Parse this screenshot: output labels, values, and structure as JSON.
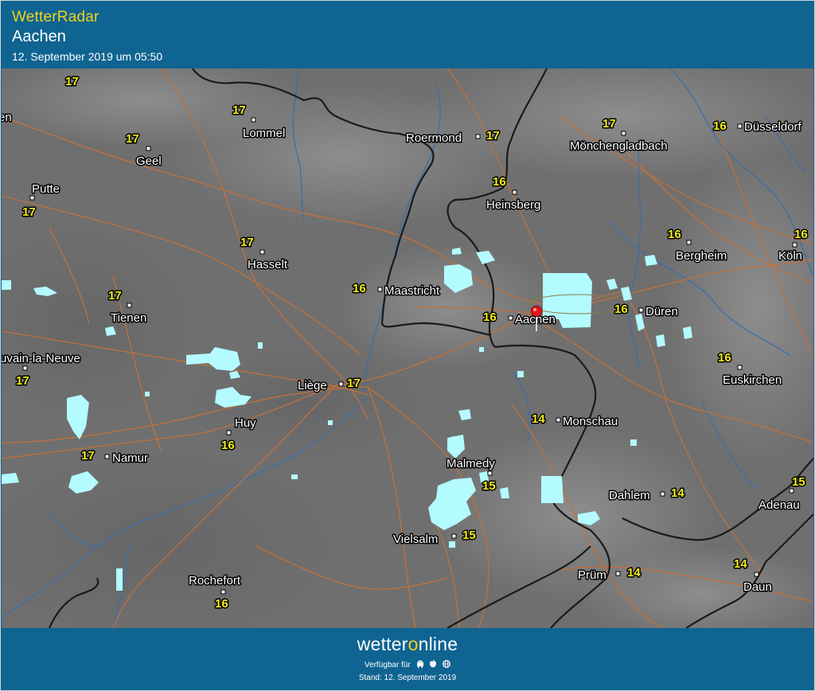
{
  "header": {
    "app_title": "WetterRadar",
    "location": "Aachen",
    "timestamp": "12. September 2019 um 05:50"
  },
  "footer": {
    "logo_pre": "wetter",
    "logo_o": "o",
    "logo_post": "nline",
    "available_label": "Verfügbar für",
    "platform_icons": [
      "android-icon",
      "apple-icon",
      "web-icon"
    ],
    "stand_label": "Stand: 12. September 2019"
  },
  "colors": {
    "header_bg": "#0f6491",
    "brand_yellow": "#f2d21b",
    "temperature_yellow": "#f5ee16",
    "precipitation": "#b3fbff",
    "road": "#c2703a",
    "border": "#1a1a1a",
    "river": "#3f6fa5"
  },
  "map": {
    "marker": "location-pin-icon",
    "cities": [
      {
        "name": "Lommel",
        "temp": ""
      },
      {
        "name": "Roermond",
        "temp": "17"
      },
      {
        "name": "Mönchengladbach",
        "temp": "17"
      },
      {
        "name": "Düsseldorf",
        "temp": "16"
      },
      {
        "name": "Geel",
        "temp": "17"
      },
      {
        "name": "Putte",
        "temp": "17"
      },
      {
        "name": "Heinsberg",
        "temp": "16"
      },
      {
        "name": "Hasselt",
        "temp": "17"
      },
      {
        "name": "Bergheim",
        "temp": "16"
      },
      {
        "name": "Köln",
        "temp": "16"
      },
      {
        "name": "Maastricht",
        "temp": "16"
      },
      {
        "name": "Tienen",
        "temp": "17"
      },
      {
        "name": "Aachen",
        "temp": "16"
      },
      {
        "name": "Düren",
        "temp": "16"
      },
      {
        "name": "uvain-la-Neuve",
        "temp": "17"
      },
      {
        "name": "Euskirchen",
        "temp": "16"
      },
      {
        "name": "Liège",
        "temp": "17"
      },
      {
        "name": "Huy",
        "temp": "16"
      },
      {
        "name": "Monschau",
        "temp": "14"
      },
      {
        "name": "Namur",
        "temp": "17"
      },
      {
        "name": "Malmedy",
        "temp": "15"
      },
      {
        "name": "Dahlem",
        "temp": "14"
      },
      {
        "name": "Adenau",
        "temp": "15"
      },
      {
        "name": "Vielsalm",
        "temp": "15"
      },
      {
        "name": "Prüm",
        "temp": "14"
      },
      {
        "name": "Daun",
        "temp": "14"
      },
      {
        "name": "Rochefort",
        "temp": "16"
      },
      {
        "name": "en",
        "temp": ""
      }
    ],
    "extra_temps": [
      "17",
      "17"
    ]
  }
}
